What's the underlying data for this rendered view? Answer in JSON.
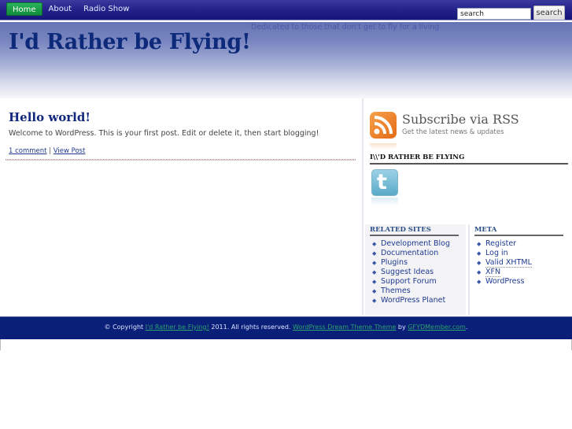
{
  "nav": {
    "items": [
      {
        "label": "Home",
        "active": true
      },
      {
        "label": "About",
        "active": false
      },
      {
        "label": "Radio Show",
        "active": false
      }
    ],
    "search_value": "search",
    "search_button": "search"
  },
  "header": {
    "tagline": "Dedicated to those that don't get to fly for a living",
    "title": "I'd Rather be Flying!"
  },
  "post": {
    "title": "Hello world!",
    "body": "Welcome to WordPress. This is your first post. Edit or delete it, then start blogging!",
    "comments_link": "1 comment",
    "separator": "|",
    "view_link": "View Post"
  },
  "sidebar": {
    "rss_title": "Subscribe via RSS",
    "rss_subtitle": "Get the latest news & updates",
    "flying_heading": "I\\\\'D RATHER BE FLYING",
    "twitter_glyph": "t",
    "related": {
      "title": "RELATED SITES",
      "items": [
        "Development Blog",
        "Documentation",
        "Plugins",
        "Suggest Ideas",
        "Support Forum",
        "Themes",
        "WordPress Planet"
      ]
    },
    "meta": {
      "title": "META",
      "items": [
        "Register",
        "Log in",
        "Valid XHTML",
        "XFN",
        "WordPress"
      ]
    }
  },
  "footer": {
    "prefix": "© Copyright ",
    "site_link": "I'd Rather be Flying!",
    "middle": " 2011. All rights reserved. ",
    "theme_link": "WordPress Dream Theme Theme",
    "by": " by ",
    "author_link": "GFYDMember.com",
    "suffix": "."
  }
}
